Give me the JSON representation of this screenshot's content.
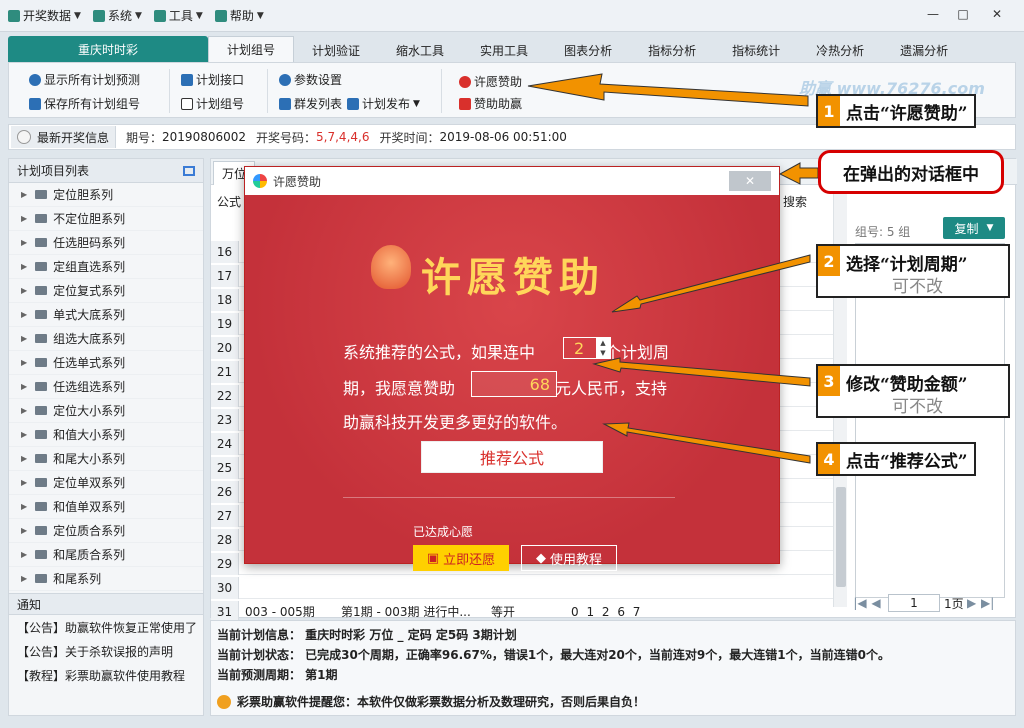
{
  "menubar": {
    "items": [
      {
        "label": "开奖数据",
        "icon": "trophy-icon"
      },
      {
        "label": "系统",
        "icon": "monitor-icon"
      },
      {
        "label": "工具",
        "icon": "tools-icon"
      },
      {
        "label": "帮助",
        "icon": "help-icon"
      }
    ],
    "win_controls": [
      "minimize",
      "maximize",
      "close"
    ]
  },
  "tabs": {
    "game": "重庆时时彩",
    "items": [
      "计划组号",
      "计划验证",
      "缩水工具",
      "实用工具",
      "图表分析",
      "指标分析",
      "指标统计",
      "冷热分析",
      "遗漏分析"
    ],
    "selected_index": 0
  },
  "toolbar": {
    "show_all": "显示所有计划预测",
    "save_all": "保存所有计划组号",
    "plan_api": "计划接口",
    "plan_group": "计划组号",
    "params": "参数设置",
    "mass_list": "群发列表",
    "plan_publish": "计划发布",
    "wish_sponsor": "许愿赞助",
    "sponsor": "赞助助赢",
    "watermark": "助赢 www.76276.com"
  },
  "infobar": {
    "latest": "最新开奖信息",
    "period_label": "期号：",
    "period": "20190806002",
    "numbers_label": "开奖号码：",
    "numbers": "5,7,4,4,6",
    "time_label": "开奖时间：",
    "time": "2019-08-06 00:51:00"
  },
  "sidebar": {
    "title": "计划项目列表",
    "items": [
      "定位胆系列",
      "不定位胆系列",
      "任选胆码系列",
      "定组直选系列",
      "定位复式系列",
      "单式大底系列",
      "组选大底系列",
      "任选单式系列",
      "任选组选系列",
      "定位大小系列",
      "和值大小系列",
      "和尾大小系列",
      "定位单双系列",
      "和值单双系列",
      "定位质合系列",
      "和尾质合系列",
      "和尾系列"
    ],
    "notice_title": "通知",
    "notices": [
      "【公告】助赢软件恢复正常使用了",
      "【公告】关于杀软误报的声明",
      "【教程】彩票助赢软件使用教程"
    ]
  },
  "main": {
    "tab": "万位",
    "formula": "公式",
    "search": "搜索",
    "row_numbers": [
      "16",
      "17",
      "18",
      "19",
      "20",
      "21",
      "22",
      "23",
      "24",
      "25",
      "26",
      "27",
      "28",
      "29",
      "30",
      "31"
    ],
    "last_row": {
      "num": "31",
      "range": "003 - 005期",
      "status": "第1期 - 003期 进行中...",
      "result": "等开",
      "digits": "0 1 2 6 7"
    },
    "group_label": "组号: 5 组",
    "copy": "复制",
    "pager": {
      "page": "1",
      "total": "1页"
    }
  },
  "status": {
    "info": "当前计划信息：  重庆时时彩    万位 _ 定码    定5码    3期计划",
    "state": "当前计划状态：  已完成30个周期，正确率96.67%，错误1个，最大连对20个，当前连对9个，最大连错1个，当前连错0个。",
    "predict": "当前预测周期：  第1期",
    "warning": "彩票助赢软件提醒您：本软件仅做彩票数据分析及数理研究，否则后果自负！"
  },
  "dialog": {
    "title": "许愿赞助",
    "close": "✕",
    "heading": "许愿赞助",
    "line1_a": "系统推荐的公式，如果连中",
    "cycles": "2",
    "line1_b": "个计划周",
    "line2_a": "期，我愿意赞助",
    "amount": "68",
    "line2_b": "元人民币，支持",
    "line3": "助赢科技开发更多更好的软件。",
    "recommend": "推荐公式",
    "achieved": "已达成心愿",
    "repay": "立即还愿",
    "tutorial": "使用教程"
  },
  "annotations": {
    "step1": {
      "num": "1",
      "text": "点击“许愿赞助”"
    },
    "bubble": "在弹出的对话框中",
    "step2": {
      "num": "2",
      "text": "选择“计划周期”",
      "note": "可不改"
    },
    "step3": {
      "num": "3",
      "text": "修改“赞助金额”",
      "note": "可不改"
    },
    "step4": {
      "num": "4",
      "text": "点击“推荐公式”"
    }
  },
  "colors": {
    "accent": "#1e8a84",
    "dialog_bg": "#d0393f",
    "gold": "#ffd65a",
    "annotation": "#f29200",
    "bubble_border": "#d60000"
  }
}
